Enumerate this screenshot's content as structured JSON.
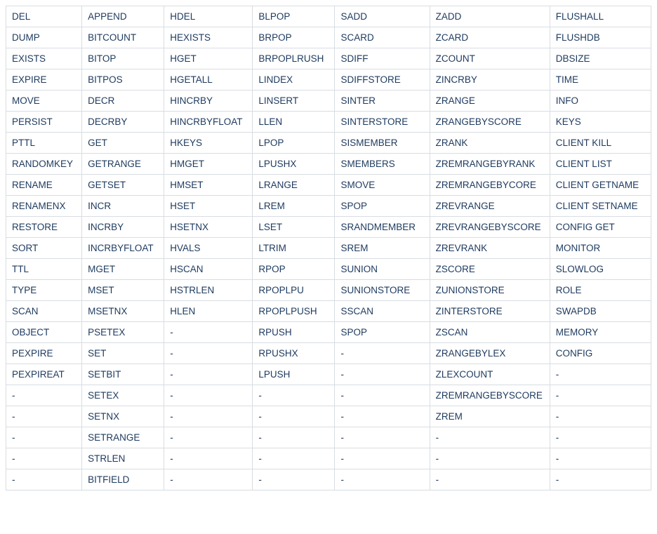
{
  "table": {
    "rows": [
      [
        "DEL",
        "APPEND",
        "HDEL",
        "BLPOP",
        "SADD",
        "ZADD",
        "FLUSHALL"
      ],
      [
        "DUMP",
        "BITCOUNT",
        "HEXISTS",
        "BRPOP",
        "SCARD",
        "ZCARD",
        "FLUSHDB"
      ],
      [
        "EXISTS",
        "BITOP",
        "HGET",
        "BRPOPLRUSH",
        "SDIFF",
        "ZCOUNT",
        "DBSIZE"
      ],
      [
        "EXPIRE",
        "BITPOS",
        "HGETALL",
        "LINDEX",
        "SDIFFSTORE",
        "ZINCRBY",
        "TIME"
      ],
      [
        "MOVE",
        "DECR",
        "HINCRBY",
        "LINSERT",
        "SINTER",
        "ZRANGE",
        "INFO"
      ],
      [
        "PERSIST",
        "DECRBY",
        "HINCRBYFLOAT",
        "LLEN",
        "SINTERSTORE",
        "ZRANGEBYSCORE",
        "KEYS"
      ],
      [
        "PTTL",
        "GET",
        "HKEYS",
        "LPOP",
        "SISMEMBER",
        "ZRANK",
        "CLIENT KILL"
      ],
      [
        "RANDOMKEY",
        "GETRANGE",
        "HMGET",
        "LPUSHX",
        "SMEMBERS",
        "ZREMRANGEBYRANK",
        "CLIENT LIST"
      ],
      [
        "RENAME",
        "GETSET",
        "HMSET",
        "LRANGE",
        "SMOVE",
        "ZREMRANGEBYCORE",
        "CLIENT GETNAME"
      ],
      [
        "RENAMENX",
        "INCR",
        "HSET",
        "LREM",
        "SPOP",
        "ZREVRANGE",
        "CLIENT SETNAME"
      ],
      [
        "RESTORE",
        "INCRBY",
        "HSETNX",
        "LSET",
        "SRANDMEMBER",
        "ZREVRANGEBYSCORE",
        "CONFIG GET"
      ],
      [
        "SORT",
        "INCRBYFLOAT",
        "HVALS",
        "LTRIM",
        "SREM",
        "ZREVRANK",
        "MONITOR"
      ],
      [
        "TTL",
        "MGET",
        "HSCAN",
        "RPOP",
        "SUNION",
        "ZSCORE",
        "SLOWLOG"
      ],
      [
        "TYPE",
        "MSET",
        "HSTRLEN",
        "RPOPLPU",
        "SUNIONSTORE",
        "ZUNIONSTORE",
        "ROLE"
      ],
      [
        "SCAN",
        "MSETNX",
        "HLEN",
        "RPOPLPUSH",
        "SSCAN",
        "ZINTERSTORE",
        "SWAPDB"
      ],
      [
        "OBJECT",
        "PSETEX",
        "-",
        "RPUSH",
        "SPOP",
        "ZSCAN",
        "MEMORY"
      ],
      [
        "PEXPIRE",
        "SET",
        "-",
        "RPUSHX",
        "-",
        "ZRANGEBYLEX",
        "CONFIG"
      ],
      [
        "PEXPIREAT",
        "SETBIT",
        "-",
        "LPUSH",
        "-",
        "ZLEXCOUNT",
        "-"
      ],
      [
        "-",
        "SETEX",
        "-",
        "-",
        "-",
        "ZREMRANGEBYSCORE",
        "-"
      ],
      [
        "-",
        "SETNX",
        "-",
        "-",
        "-",
        "ZREM",
        "-"
      ],
      [
        "-",
        "SETRANGE",
        "-",
        "-",
        "-",
        "-",
        "-"
      ],
      [
        "-",
        "STRLEN",
        "-",
        "-",
        "-",
        "-",
        "-"
      ],
      [
        "-",
        "BITFIELD",
        "-",
        "-",
        "-",
        "-",
        "-"
      ]
    ]
  }
}
